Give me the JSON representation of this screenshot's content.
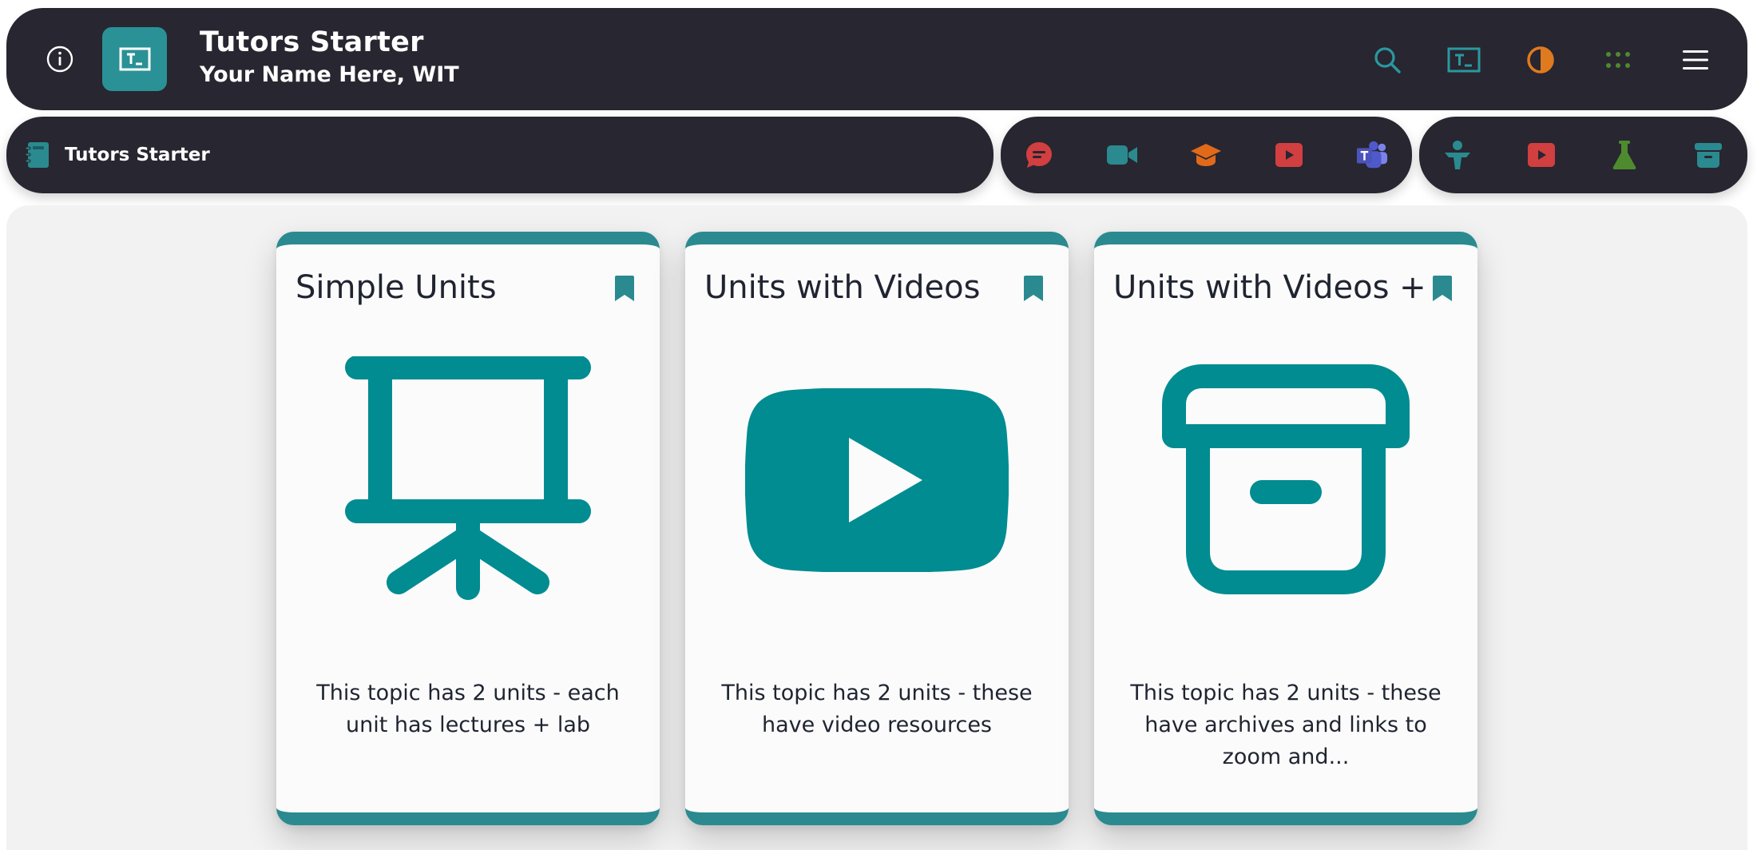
{
  "header": {
    "title": "Tutors Starter",
    "subtitle": "Your Name Here, WIT",
    "icons": {
      "info": "info-icon",
      "logo": "tutors-logo-icon",
      "search": "search-icon",
      "tutors": "tutors-logo-icon",
      "theme": "contrast-icon",
      "apps": "apps-grid-icon",
      "menu": "hamburger-menu-icon"
    }
  },
  "breadcrumb": {
    "label": "Tutors Starter",
    "icon": "course-notebook-icon"
  },
  "resource_bar": [
    {
      "icon": "chat-bubble-icon",
      "color": "#d13f40"
    },
    {
      "icon": "video-camera-icon",
      "color": "#2a8a8f"
    },
    {
      "icon": "graduation-cap-icon",
      "color": "#e06a1a"
    },
    {
      "icon": "youtube-play-icon",
      "color": "#d13f40"
    },
    {
      "icon": "teams-icon",
      "color": "#5059c9"
    }
  ],
  "type_bar": [
    {
      "icon": "presenter-icon",
      "color": "#2a8a8f"
    },
    {
      "icon": "video-play-icon",
      "color": "#d13f40"
    },
    {
      "icon": "flask-icon",
      "color": "#4e8a2e"
    },
    {
      "icon": "archive-box-icon",
      "color": "#2a8a8f"
    }
  ],
  "cards": [
    {
      "title": "Simple Units",
      "summary": "This topic has 2 units - each unit has lectures + lab",
      "icon": "presentation-board-icon"
    },
    {
      "title": "Units with Videos",
      "summary": "This topic has 2 units - these have video resources",
      "icon": "youtube-icon"
    },
    {
      "title": "Units with Videos +",
      "summary": "This topic has 2 units - these have archives and links to zoom and...",
      "icon": "archive-icon"
    }
  ],
  "colors": {
    "bar_bg": "#282630",
    "accent": "#2a8a8f",
    "icon_teal": "#008c90",
    "panel_bg": "#f2f2f3",
    "card_bg": "#fbfbfc"
  }
}
